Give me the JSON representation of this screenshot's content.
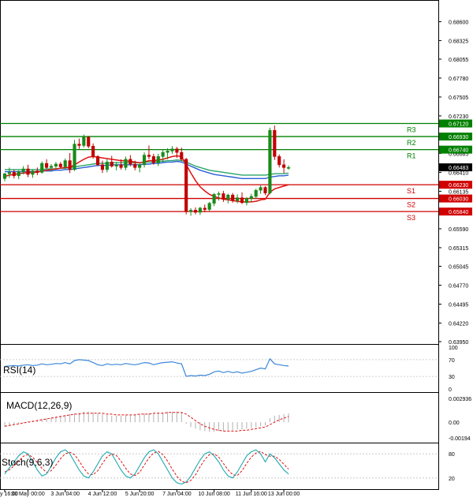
{
  "chart_data": {
    "type": "candlestick",
    "main": {
      "price_axis_ticks": [
        "0.68600",
        "0.68325",
        "0.68055",
        "0.67780",
        "0.67505",
        "0.67230",
        "0.66685",
        "0.66410",
        "0.66135",
        "0.65590",
        "0.65315",
        "0.65045",
        "0.64770",
        "0.64495",
        "0.64220",
        "0.63950"
      ],
      "ylim": [
        0.6395,
        0.6888
      ],
      "levels": [
        {
          "name": "R3",
          "value": 0.6712,
          "label": "0.67120",
          "color": "#008000"
        },
        {
          "name": "R2",
          "value": 0.6693,
          "label": "0.66930",
          "color": "#008000"
        },
        {
          "name": "R1",
          "value": 0.6674,
          "label": "0.66740",
          "color": "#008000"
        },
        {
          "name": "S1",
          "value": 0.6623,
          "label": "0.66230",
          "color": "#d00000"
        },
        {
          "name": "S2",
          "value": 0.6603,
          "label": "0.66030",
          "color": "#d00000"
        },
        {
          "name": "S3",
          "value": 0.6584,
          "label": "0.65840",
          "color": "#d00000"
        }
      ],
      "current_price": {
        "value": 0.66483,
        "label": "0.66483"
      },
      "candles": [
        [
          0.6632,
          0.664,
          0.6628,
          0.6639
        ],
        [
          0.6639,
          0.6648,
          0.6633,
          0.6641
        ],
        [
          0.6641,
          0.6645,
          0.6632,
          0.6636
        ],
        [
          0.6636,
          0.6644,
          0.6631,
          0.6642
        ],
        [
          0.6642,
          0.665,
          0.6638,
          0.6646
        ],
        [
          0.6646,
          0.6652,
          0.6634,
          0.6638
        ],
        [
          0.6638,
          0.6645,
          0.6633,
          0.6643
        ],
        [
          0.6643,
          0.6648,
          0.6637,
          0.6641
        ],
        [
          0.6641,
          0.6657,
          0.6639,
          0.6654
        ],
        [
          0.6654,
          0.666,
          0.6646,
          0.6648
        ],
        [
          0.6648,
          0.6653,
          0.6642,
          0.665
        ],
        [
          0.665,
          0.6656,
          0.6645,
          0.6653
        ],
        [
          0.6653,
          0.6656,
          0.6647,
          0.6649
        ],
        [
          0.6649,
          0.6661,
          0.6646,
          0.6658
        ],
        [
          0.6658,
          0.6669,
          0.664,
          0.6645
        ],
        [
          0.6645,
          0.6688,
          0.6643,
          0.6682
        ],
        [
          0.6682,
          0.669,
          0.6675,
          0.668
        ],
        [
          0.668,
          0.6696,
          0.6677,
          0.6692
        ],
        [
          0.6692,
          0.6694,
          0.6676,
          0.6679
        ],
        [
          0.6679,
          0.6683,
          0.6661,
          0.6664
        ],
        [
          0.6664,
          0.6666,
          0.665,
          0.6652
        ],
        [
          0.6652,
          0.6658,
          0.664,
          0.6645
        ],
        [
          0.6645,
          0.666,
          0.6641,
          0.6656
        ],
        [
          0.6656,
          0.6665,
          0.6648,
          0.665
        ],
        [
          0.665,
          0.6656,
          0.6644,
          0.6652
        ],
        [
          0.6652,
          0.666,
          0.6645,
          0.6648
        ],
        [
          0.6648,
          0.6664,
          0.6644,
          0.666
        ],
        [
          0.666,
          0.6666,
          0.665,
          0.6653
        ],
        [
          0.6653,
          0.6658,
          0.6644,
          0.6648
        ],
        [
          0.6648,
          0.6655,
          0.6641,
          0.6652
        ],
        [
          0.6652,
          0.667,
          0.6648,
          0.6666
        ],
        [
          0.6666,
          0.668,
          0.666,
          0.6664
        ],
        [
          0.6664,
          0.6668,
          0.6652,
          0.6655
        ],
        [
          0.6655,
          0.6668,
          0.665,
          0.6664
        ],
        [
          0.6664,
          0.6674,
          0.6656,
          0.667
        ],
        [
          0.667,
          0.6676,
          0.666,
          0.6672
        ],
        [
          0.6672,
          0.6679,
          0.6668,
          0.6675
        ],
        [
          0.6675,
          0.6678,
          0.6662,
          0.667
        ],
        [
          0.667,
          0.6677,
          0.6658,
          0.666
        ],
        [
          0.666,
          0.6662,
          0.658,
          0.6584
        ],
        [
          0.6584,
          0.6589,
          0.6578,
          0.6586
        ],
        [
          0.6586,
          0.659,
          0.658,
          0.6583
        ],
        [
          0.6583,
          0.6591,
          0.6579,
          0.6589
        ],
        [
          0.6589,
          0.6594,
          0.6583,
          0.6587
        ],
        [
          0.6587,
          0.6598,
          0.6585,
          0.6596
        ],
        [
          0.6596,
          0.6611,
          0.6592,
          0.6609
        ],
        [
          0.6609,
          0.6613,
          0.66,
          0.661
        ],
        [
          0.661,
          0.6614,
          0.6598,
          0.6602
        ],
        [
          0.6602,
          0.661,
          0.6596,
          0.6608
        ],
        [
          0.6608,
          0.6611,
          0.6597,
          0.66
        ],
        [
          0.66,
          0.6609,
          0.6596,
          0.6604
        ],
        [
          0.6604,
          0.6612,
          0.6595,
          0.6597
        ],
        [
          0.6597,
          0.6605,
          0.6593,
          0.6603
        ],
        [
          0.6603,
          0.661,
          0.6598,
          0.6606
        ],
        [
          0.6606,
          0.6617,
          0.6602,
          0.6615
        ],
        [
          0.6615,
          0.6622,
          0.661,
          0.6619
        ],
        [
          0.6619,
          0.6621,
          0.6608,
          0.6611
        ],
        [
          0.6611,
          0.6706,
          0.6609,
          0.6702
        ],
        [
          0.6702,
          0.6709,
          0.6659,
          0.6664
        ],
        [
          0.6664,
          0.6667,
          0.6648,
          0.6652
        ],
        [
          0.6652,
          0.666,
          0.664,
          0.6648
        ],
        [
          0.6648,
          0.6651,
          0.6645,
          0.6648
        ]
      ],
      "ma_fast_color": "#e01010",
      "ma_slow_color": "#2a5fd8",
      "ma_third_color": "#2aa56a",
      "ma_fast": [
        0.6635,
        0.6637,
        0.6638,
        0.6639,
        0.664,
        0.664,
        0.6641,
        0.6641,
        0.6643,
        0.6644,
        0.6645,
        0.6646,
        0.6647,
        0.6648,
        0.6648,
        0.6652,
        0.6656,
        0.666,
        0.6663,
        0.6664,
        0.6663,
        0.6662,
        0.6661,
        0.666,
        0.6659,
        0.6658,
        0.6658,
        0.6657,
        0.6656,
        0.6655,
        0.6656,
        0.6658,
        0.6658,
        0.6659,
        0.666,
        0.6662,
        0.6664,
        0.6665,
        0.6664,
        0.6652,
        0.664,
        0.6629,
        0.662,
        0.6614,
        0.6609,
        0.6606,
        0.6604,
        0.6602,
        0.6601,
        0.66,
        0.6599,
        0.6598,
        0.6598,
        0.6598,
        0.6599,
        0.6601,
        0.6602,
        0.6612,
        0.6617,
        0.6619,
        0.6621,
        0.6623
      ],
      "ma_slow": [
        0.6642,
        0.6642,
        0.6642,
        0.6642,
        0.6642,
        0.6642,
        0.6642,
        0.6642,
        0.6643,
        0.6643,
        0.6643,
        0.6644,
        0.6644,
        0.6645,
        0.6645,
        0.6646,
        0.6647,
        0.6648,
        0.6649,
        0.665,
        0.6651,
        0.6651,
        0.6651,
        0.6652,
        0.6652,
        0.6652,
        0.6652,
        0.6652,
        0.6652,
        0.6652,
        0.6653,
        0.6653,
        0.6654,
        0.6654,
        0.6655,
        0.6656,
        0.6656,
        0.6657,
        0.6656,
        0.6653,
        0.665,
        0.6647,
        0.6644,
        0.6642,
        0.664,
        0.6638,
        0.6637,
        0.6636,
        0.6635,
        0.6634,
        0.6633,
        0.6632,
        0.6632,
        0.6632,
        0.6632,
        0.6632,
        0.6632,
        0.6634,
        0.6635,
        0.6636,
        0.6636,
        0.6637
      ],
      "ma_third": [
        0.6645,
        0.6645,
        0.6645,
        0.6645,
        0.6645,
        0.6645,
        0.6645,
        0.6645,
        0.6645,
        0.6646,
        0.6646,
        0.6646,
        0.6647,
        0.6647,
        0.6648,
        0.6649,
        0.665,
        0.6651,
        0.6652,
        0.6653,
        0.6654,
        0.6654,
        0.6654,
        0.6655,
        0.6655,
        0.6655,
        0.6655,
        0.6655,
        0.6655,
        0.6655,
        0.6656,
        0.6656,
        0.6656,
        0.6657,
        0.6657,
        0.6658,
        0.6658,
        0.6659,
        0.6658,
        0.6656,
        0.6653,
        0.665,
        0.6648,
        0.6646,
        0.6644,
        0.6643,
        0.6642,
        0.6641,
        0.664,
        0.6639,
        0.6638,
        0.6637,
        0.6637,
        0.6637,
        0.6637,
        0.6637,
        0.6637,
        0.6638,
        0.6639,
        0.6639,
        0.6639,
        0.664
      ]
    },
    "x_axis": {
      "labels": [
        {
          "text": "y 16:00",
          "index": 0
        },
        {
          "text": "31 May 00:00",
          "index": 5
        },
        {
          "text": "3 Jun 04:00",
          "index": 13
        },
        {
          "text": "4 Jun 12:00",
          "index": 21
        },
        {
          "text": "5 Jun 20:00",
          "index": 29
        },
        {
          "text": "7 Jun 04:00",
          "index": 37
        },
        {
          "text": "10 Jun 08:00",
          "index": 45
        },
        {
          "text": "11 Jun 16:00",
          "index": 53
        },
        {
          "text": "13 Jun 00:00",
          "index": 60
        }
      ]
    },
    "rsi": {
      "label": "RSI(14)",
      "ticks": [
        "100",
        "70",
        "30",
        "0"
      ],
      "ylim": [
        0,
        100
      ],
      "color": "#3a86d8",
      "values": [
        54,
        55,
        56,
        55,
        57,
        58,
        56,
        57,
        60,
        58,
        59,
        61,
        60,
        63,
        60,
        68,
        70,
        69,
        68,
        63,
        58,
        56,
        60,
        58,
        59,
        58,
        61,
        59,
        58,
        60,
        63,
        62,
        58,
        61,
        63,
        64,
        65,
        62,
        60,
        30,
        32,
        31,
        33,
        32,
        35,
        41,
        43,
        39,
        42,
        39,
        41,
        38,
        40,
        42,
        46,
        50,
        48,
        72,
        60,
        58,
        56,
        55
      ]
    },
    "macd": {
      "label": "MACD(12,26,9)",
      "ticks": [
        "0.002936",
        "0.00",
        "-0.00194"
      ],
      "ylim": [
        -0.00194,
        0.002936
      ],
      "hist_color": "#b0b0b0",
      "signal_color": "#e01010",
      "hist": [
        -0.0006,
        -0.0004,
        -0.0003,
        -0.0002,
        -0.0001,
        0.0001,
        0.0002,
        0.0003,
        0.0004,
        0.0005,
        0.0006,
        0.0007,
        0.0008,
        0.0009,
        0.001,
        0.0011,
        0.0012,
        0.0013,
        0.0013,
        0.0012,
        0.0011,
        0.001,
        0.0009,
        0.0008,
        0.0008,
        0.0008,
        0.0009,
        0.0009,
        0.001,
        0.001,
        0.0011,
        0.0011,
        0.0011,
        0.0012,
        0.0012,
        0.0013,
        0.0013,
        0.0013,
        0.0012,
        -0.0002,
        -0.0006,
        -0.0008,
        -0.001,
        -0.0011,
        -0.0012,
        -0.0012,
        -0.0011,
        -0.0011,
        -0.001,
        -0.001,
        -0.0009,
        -0.0009,
        -0.0008,
        -0.0007,
        -0.0006,
        -0.0005,
        -0.0004,
        0.0005,
        0.0008,
        0.0009,
        0.001,
        0.0011
      ],
      "signal": [
        -0.0005,
        -0.0004,
        -0.0003,
        -0.0002,
        -0.0001,
        0.0,
        0.0001,
        0.0002,
        0.0003,
        0.0004,
        0.0005,
        0.0006,
        0.0007,
        0.0008,
        0.0009,
        0.001,
        0.001,
        0.0011,
        0.0011,
        0.0011,
        0.0011,
        0.0011,
        0.001,
        0.001,
        0.0009,
        0.0009,
        0.0009,
        0.0009,
        0.0009,
        0.001,
        0.001,
        0.001,
        0.0011,
        0.0011,
        0.0011,
        0.0012,
        0.0012,
        0.0012,
        0.0012,
        0.001,
        0.0006,
        0.0002,
        -0.0002,
        -0.0005,
        -0.0007,
        -0.0009,
        -0.001,
        -0.0011,
        -0.0011,
        -0.0011,
        -0.0011,
        -0.001,
        -0.001,
        -0.0009,
        -0.0008,
        -0.0007,
        -0.0006,
        -0.0003,
        0.0,
        0.0003,
        0.0005,
        0.0007
      ]
    },
    "stoch": {
      "label": "Stoch(9,6,3)",
      "ticks": [
        "80",
        "20"
      ],
      "ylim": [
        0,
        100
      ],
      "k_color": "#1fa8b0",
      "d_color": "#e01010",
      "k": [
        30,
        45,
        60,
        75,
        85,
        80,
        60,
        40,
        25,
        30,
        50,
        70,
        85,
        90,
        80,
        60,
        40,
        25,
        20,
        35,
        55,
        75,
        85,
        80,
        60,
        40,
        25,
        20,
        30,
        50,
        70,
        85,
        90,
        80,
        60,
        40,
        20,
        8,
        5,
        10,
        25,
        45,
        65,
        80,
        85,
        75,
        60,
        40,
        25,
        20,
        35,
        55,
        75,
        85,
        90,
        80,
        60,
        80,
        70,
        55,
        40,
        30
      ],
      "d": [
        35,
        40,
        50,
        62,
        74,
        78,
        72,
        58,
        44,
        34,
        38,
        52,
        68,
        80,
        84,
        78,
        62,
        44,
        30,
        28,
        38,
        56,
        72,
        80,
        76,
        62,
        44,
        30,
        26,
        34,
        52,
        70,
        82,
        86,
        78,
        62,
        42,
        24,
        12,
        8,
        14,
        28,
        48,
        66,
        78,
        80,
        72,
        56,
        40,
        28,
        26,
        38,
        56,
        72,
        82,
        86,
        78,
        74,
        74,
        66,
        54,
        42
      ]
    }
  }
}
